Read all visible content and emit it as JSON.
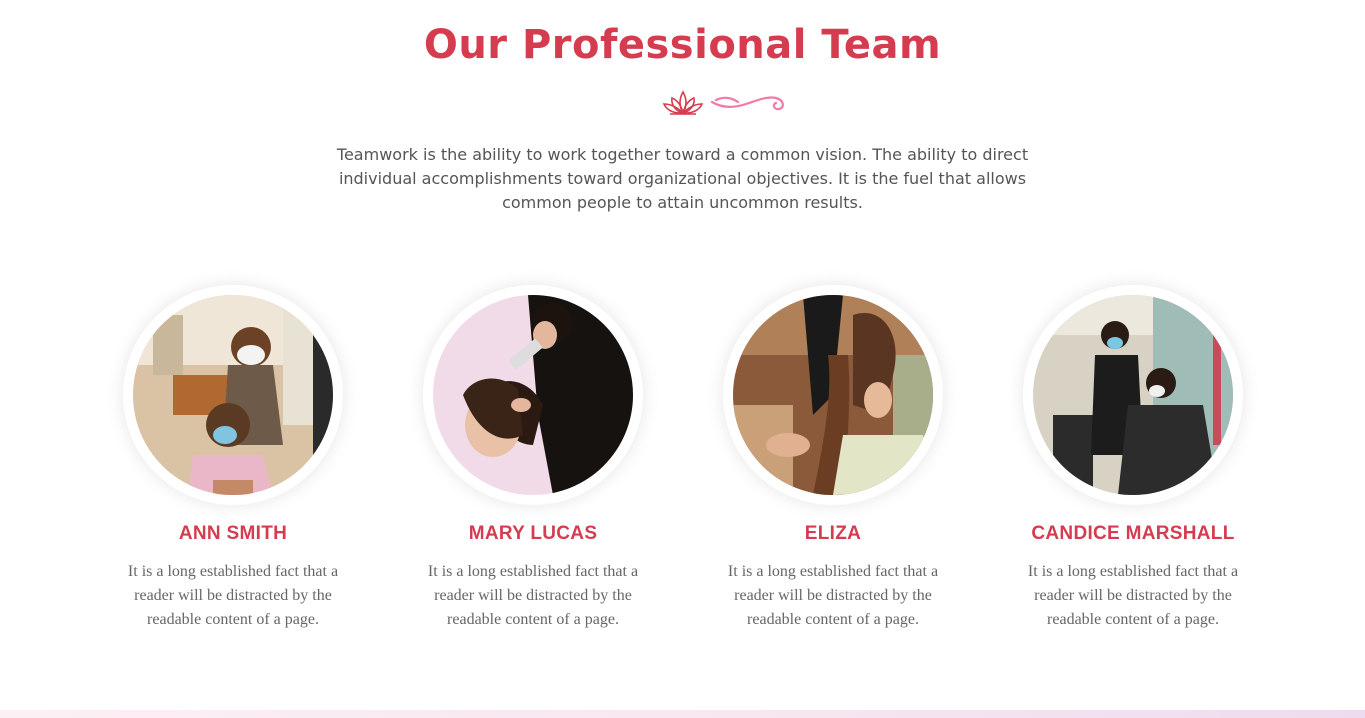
{
  "section": {
    "title": "Our Professional Team",
    "intro": "Teamwork is the ability to work together toward a common vision. The ability to direct individual accomplishments toward organizational objectives. It is the fuel that allows common people to attain uncommon results."
  },
  "ornament": {
    "icons": [
      "lotus-icon",
      "swirl-icon"
    ],
    "colors": {
      "lotus": "#d63c4f",
      "swirl": "#f27aa6"
    }
  },
  "team": [
    {
      "name": "ANN SMITH",
      "description": "It is a long established fact that a reader will be distracted by the readable content of a page."
    },
    {
      "name": "MARY LUCAS",
      "description": "It is a long established fact that a reader will be distracted by the readable content of a page."
    },
    {
      "name": "ELIZA",
      "description": "It is a long established fact that a reader will be distracted by the readable content of a page."
    },
    {
      "name": "CANDICE MARSHALL",
      "description": "It is a long established fact that a reader will be distracted by the readable content of a page."
    }
  ],
  "colors": {
    "accent": "#d63c4f",
    "text": "#555555",
    "background": "#ffffff"
  }
}
